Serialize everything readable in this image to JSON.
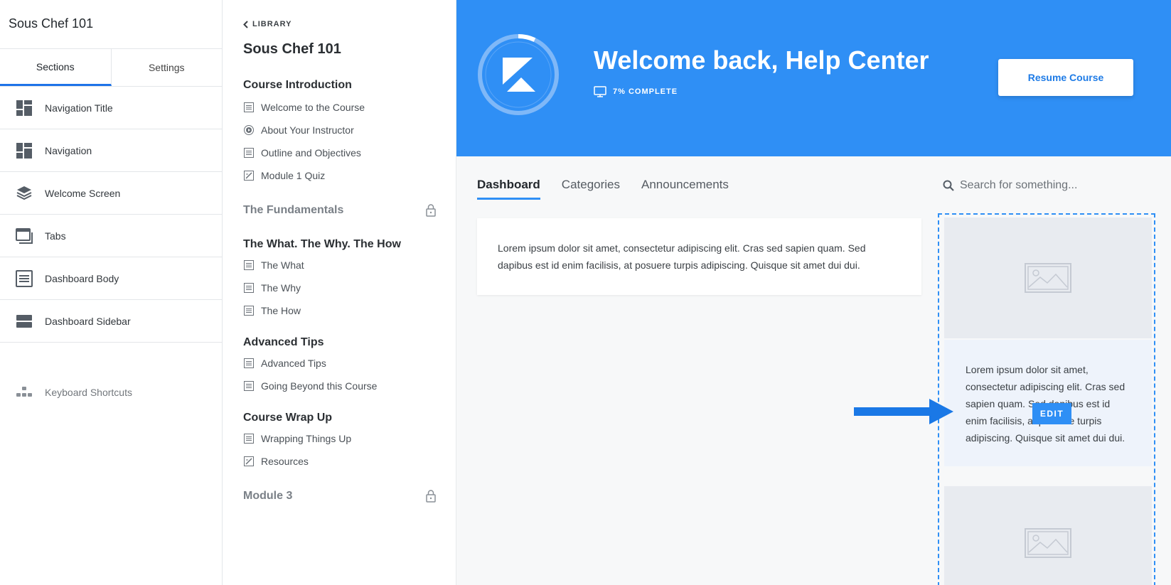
{
  "editor": {
    "title": "Sous Chef 101",
    "tabs": [
      {
        "label": "Sections",
        "active": true
      },
      {
        "label": "Settings",
        "active": false
      }
    ],
    "items": [
      {
        "label": "Navigation Title",
        "icon": "dashboard-layout-icon"
      },
      {
        "label": "Navigation",
        "icon": "dashboard-layout-icon"
      },
      {
        "label": "Welcome Screen",
        "icon": "layers-icon"
      },
      {
        "label": "Tabs",
        "icon": "windows-icon"
      },
      {
        "label": "Dashboard Body",
        "icon": "document-icon"
      },
      {
        "label": "Dashboard Sidebar",
        "icon": "rows-icon"
      }
    ],
    "shortcuts_label": "Keyboard Shortcuts"
  },
  "outline": {
    "back_label": "LIBRARY",
    "course_title": "Sous Chef 101",
    "sections": [
      {
        "title": "Course Introduction",
        "locked": false,
        "lessons": [
          {
            "label": "Welcome to the Course",
            "icon": "text-lesson-icon"
          },
          {
            "label": "About Your Instructor",
            "icon": "video-lesson-icon"
          },
          {
            "label": "Outline and Objectives",
            "icon": "text-lesson-icon"
          },
          {
            "label": "Module 1 Quiz",
            "icon": "quiz-icon"
          }
        ]
      },
      {
        "title": "The Fundamentals",
        "locked": true,
        "lessons": []
      },
      {
        "title": "The What. The Why. The How",
        "locked": false,
        "lessons": [
          {
            "label": "The What",
            "icon": "text-lesson-icon"
          },
          {
            "label": "The Why",
            "icon": "text-lesson-icon"
          },
          {
            "label": "The How",
            "icon": "text-lesson-icon"
          }
        ]
      },
      {
        "title": "Advanced Tips",
        "locked": false,
        "lessons": [
          {
            "label": "Advanced Tips",
            "icon": "text-lesson-icon"
          },
          {
            "label": "Going Beyond this Course",
            "icon": "text-lesson-icon"
          }
        ]
      },
      {
        "title": "Course Wrap Up",
        "locked": false,
        "lessons": [
          {
            "label": "Wrapping Things Up",
            "icon": "text-lesson-icon"
          },
          {
            "label": "Resources",
            "icon": "quiz-icon"
          }
        ]
      },
      {
        "title": "Module 3",
        "locked": true,
        "lessons": []
      }
    ]
  },
  "hero": {
    "welcome": "Welcome back, Help Center",
    "progress_label": "7% COMPLETE",
    "progress_fraction": 0.07,
    "resume_label": "Resume Course",
    "bg_color": "#2f8ff5"
  },
  "tabs": [
    {
      "label": "Dashboard",
      "active": true
    },
    {
      "label": "Categories",
      "active": false
    },
    {
      "label": "Announcements",
      "active": false
    }
  ],
  "search": {
    "placeholder": "Search for something..."
  },
  "body_text": "Lorem ipsum dolor sit amet, consectetur adipiscing elit. Cras sed sapien quam. Sed dapibus est id enim facilisis, at posuere turpis adipiscing. Quisque sit amet dui dui.",
  "sidebar": {
    "text": "Lorem ipsum dolor sit amet, consectetur adipiscing elit. Cras sed sapien quam. Sed dapibus est id enim facilisis, at posuere turpis adipiscing. Quisque sit amet dui dui.",
    "edit_label": "EDIT"
  },
  "colors": {
    "accent": "#2f8ff5",
    "arrow": "#1a78e6"
  }
}
